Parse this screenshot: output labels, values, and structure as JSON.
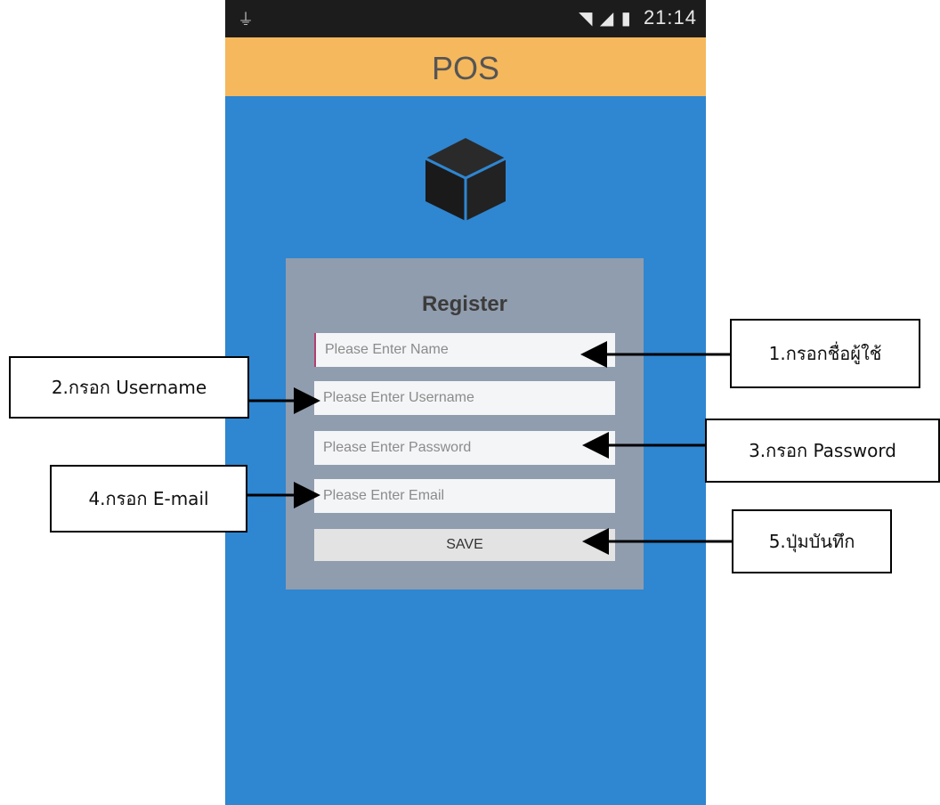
{
  "status_bar": {
    "time": "21:14",
    "icons": [
      "usb-icon",
      "wifi-icon",
      "signal-icon",
      "battery-icon"
    ]
  },
  "app_bar": {
    "title": "POS"
  },
  "register": {
    "title": "Register",
    "name_placeholder": "Please Enter Name",
    "username_placeholder": "Please Enter Username",
    "password_placeholder": "Please Enter Password",
    "email_placeholder": "Please Enter Email",
    "save_label": "SAVE"
  },
  "annotations": {
    "name": "1.กรอกชื่อผู้ใช้",
    "username": "2.กรอก Username",
    "password": "3.กรอก Password",
    "email": "4.กรอก E-mail",
    "save": "5.ปุ่มบันทึก"
  },
  "colors": {
    "background": "#2f86d1",
    "app_bar": "#f5b85c",
    "status_bar": "#1c1c1c",
    "panel": "#9ea0a8"
  }
}
